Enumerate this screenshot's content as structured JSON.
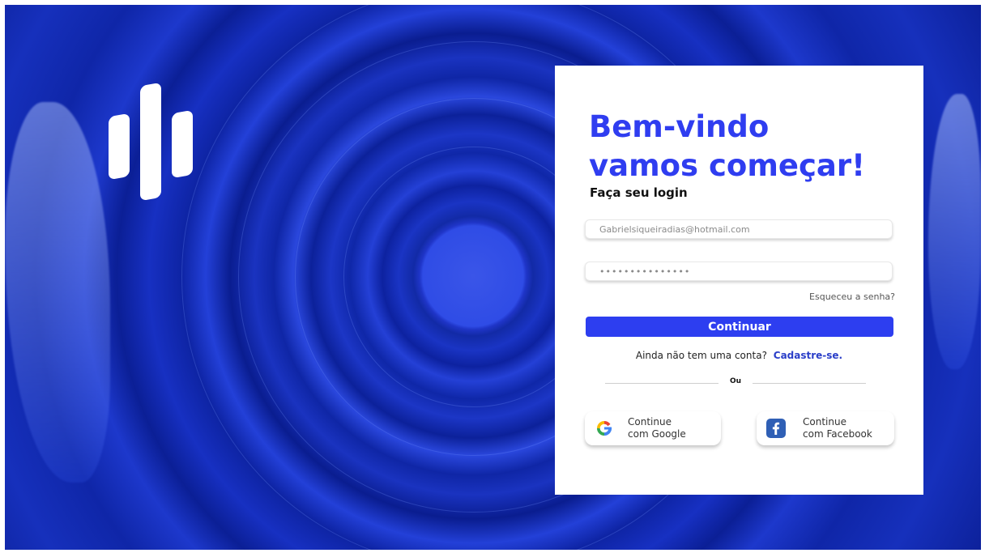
{
  "brand": {
    "logo_icon": "sound-bars-logo"
  },
  "login": {
    "title_line1": "Bem-vindo",
    "title_line2": "vamos começar!",
    "subtitle": "Faça seu login",
    "email_value": "Gabrielsiqueiradias@hotmail.com",
    "password_value": "•••••••••••••••",
    "forgot_label": "Esqueceu a senha?",
    "continue_label": "Continuar",
    "signup_prompt": "Ainda não tem uma conta?",
    "signup_link": "Cadastre-se.",
    "divider_label": "Ou",
    "google": {
      "line1": "Continue",
      "line2": "com Google",
      "icon": "google-icon"
    },
    "facebook": {
      "line1": "Continue",
      "line2": "com Facebook",
      "icon": "facebook-icon"
    }
  },
  "colors": {
    "accent": "#2f3df0",
    "link": "#2a3ec8",
    "background": "#1630bc"
  }
}
